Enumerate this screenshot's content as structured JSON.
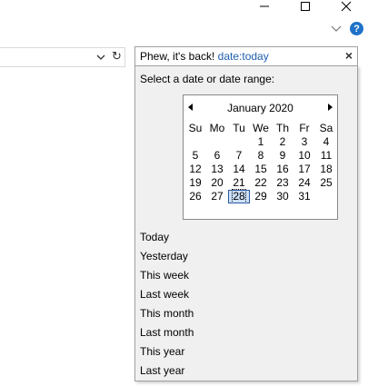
{
  "window": {
    "minimize_icon": "minimize-icon",
    "maximize_icon": "maximize-icon",
    "close_icon": "close-icon"
  },
  "toolbar": {
    "help_label": "?"
  },
  "address": {
    "refresh_glyph": "↻"
  },
  "search": {
    "text": "Phew, it's back! ",
    "token": "date:today",
    "clear_glyph": "×"
  },
  "panel": {
    "prompt": "Select a date or date range:",
    "calendar": {
      "month_label": "January 2020",
      "weekdays": [
        "Su",
        "Mo",
        "Tu",
        "We",
        "Th",
        "Fr",
        "Sa"
      ],
      "weeks": [
        [
          "",
          "",
          "",
          "1",
          "2",
          "3",
          "4"
        ],
        [
          "5",
          "6",
          "7",
          "8",
          "9",
          "10",
          "11"
        ],
        [
          "12",
          "13",
          "14",
          "15",
          "16",
          "17",
          "18"
        ],
        [
          "19",
          "20",
          "21",
          "22",
          "23",
          "24",
          "25"
        ],
        [
          "26",
          "27",
          "28",
          "29",
          "30",
          "31",
          ""
        ]
      ],
      "selected_day": "28"
    },
    "presets": [
      "Today",
      "Yesterday",
      "This week",
      "Last week",
      "This month",
      "Last month",
      "This year",
      "Last year"
    ]
  },
  "colors": {
    "token": "#1f5fad",
    "help": "#1f72c8",
    "panel_bg": "#f0f0f0",
    "selected_bg": "#cce0f8"
  }
}
